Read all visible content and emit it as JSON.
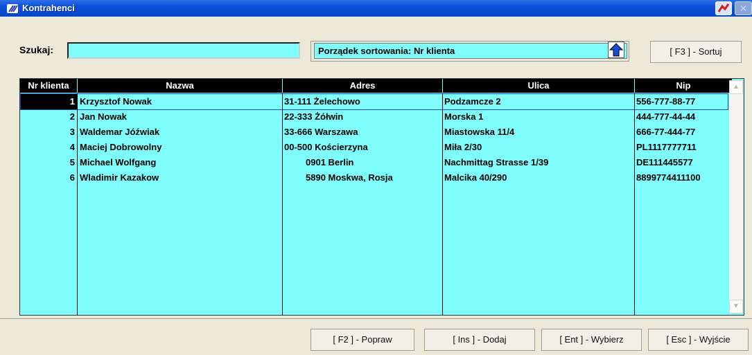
{
  "window": {
    "title": "Kontrahenci"
  },
  "search": {
    "label": "Szukaj:",
    "value": ""
  },
  "sort": {
    "text": "Porządek sortowania: Nr klienta",
    "button_label": "[ F3 ] - Sortuj",
    "arrow_icon": "up-arrow-icon"
  },
  "table": {
    "headers": [
      "Nr klienta",
      "Nazwa",
      "Adres",
      "Ulica",
      "Nip"
    ],
    "rows": [
      [
        "1",
        "Krzysztof Nowak",
        "31-111 Żelechowo",
        "Podzamcze 2",
        "556-777-88-77"
      ],
      [
        "2",
        "Jan Nowak",
        "22-333 Żółwin",
        "Morska 1",
        "444-777-44-44"
      ],
      [
        "3",
        "Waldemar Jóźwiak",
        "33-666 Warszawa",
        "Miastowska 11/4",
        "666-77-444-77"
      ],
      [
        "4",
        "Maciej Dobrowolny",
        "00-500 Kościerzyna",
        "Miła 2/30",
        "PL1117777711"
      ],
      [
        "5",
        "Michael Wolfgang",
        "0901 Berlin",
        "Nachmittag Strasse 1/39",
        "DE111445577"
      ],
      [
        "6",
        "Wladimir Kazakow",
        "5890 Moskwa, Rosja",
        "Malcika 40/290",
        "8899774411100"
      ]
    ],
    "selected_row": 0
  },
  "buttons": {
    "edit": "[ F2 ] - Popraw",
    "add": "[ Ins ] - Dodaj",
    "select": "[ Ent ] - Wybierz",
    "exit": "[ Esc ] - Wyjście"
  },
  "colors": {
    "grid_bg": "#7ffdfd",
    "title_bg": "#0b4fd9",
    "header_bg": "#000000"
  }
}
